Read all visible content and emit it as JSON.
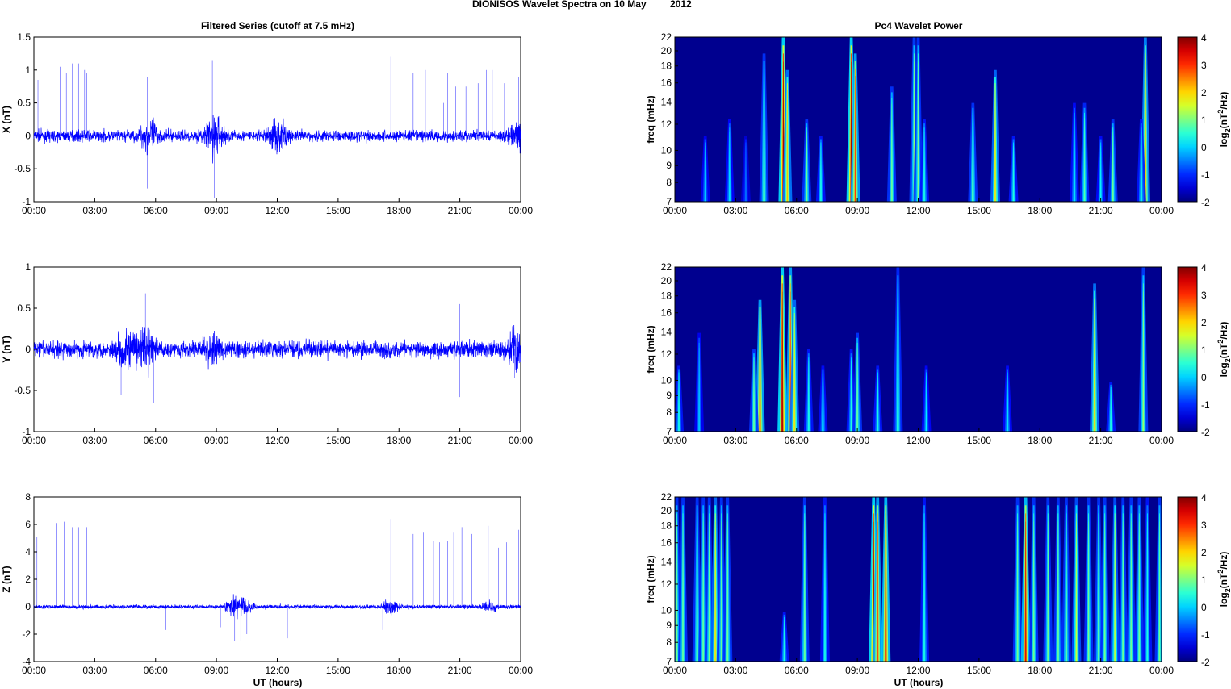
{
  "title": "DIONISOS Wavelet Spectra on 10 May",
  "year": "2012",
  "left_title": "Filtered Series (cutoff at 7.5 mHz)",
  "right_title": "Pc4 Wavelet Power",
  "xlabel": "UT (hours)",
  "x_ticks": [
    "00:00",
    "03:00",
    "06:00",
    "09:00",
    "12:00",
    "15:00",
    "18:00",
    "21:00",
    "00:00"
  ],
  "freq_label": "freq (mHz)",
  "freq_ticks": [
    7,
    8,
    9,
    10,
    12,
    14,
    16,
    18,
    20,
    22
  ],
  "colorbar": {
    "label": "log2(nT2/Hz)",
    "ticks": [
      -2,
      -1,
      0,
      1,
      2,
      3,
      4
    ],
    "range": [
      -2,
      4
    ]
  },
  "colors": {
    "line": "#0000ff",
    "background": "#00008f"
  },
  "chart_data": [
    {
      "type": "line",
      "ylabel": "X (nT)",
      "ylim": [
        -1,
        1.5
      ],
      "yticks": [
        -1,
        -0.5,
        0,
        0.5,
        1,
        1.5
      ],
      "noise": 0.06,
      "bursts": [
        [
          5.7,
          0.15
        ],
        [
          8.9,
          0.2
        ],
        [
          12.0,
          0.15
        ],
        [
          23.8,
          0.1
        ]
      ],
      "spikes": [
        [
          0.2,
          0.85
        ],
        [
          1.3,
          1.05
        ],
        [
          1.6,
          0.95
        ],
        [
          1.9,
          1.1
        ],
        [
          2.2,
          1.1
        ],
        [
          2.5,
          1.0
        ],
        [
          2.6,
          0.95
        ],
        [
          5.6,
          0.9
        ],
        [
          8.8,
          1.15
        ],
        [
          8.9,
          -0.95
        ],
        [
          17.6,
          1.2
        ],
        [
          18.7,
          0.95
        ],
        [
          19.3,
          1.0
        ],
        [
          20.2,
          0.5
        ],
        [
          20.4,
          0.95
        ],
        [
          20.8,
          0.75
        ],
        [
          21.3,
          0.75
        ],
        [
          21.9,
          0.8
        ],
        [
          22.3,
          1.0
        ],
        [
          22.6,
          1.0
        ],
        [
          23.2,
          0.8
        ],
        [
          23.9,
          0.9
        ],
        [
          5.6,
          -0.8
        ]
      ]
    },
    {
      "type": "line",
      "ylabel": "Y (nT)",
      "ylim": [
        -1,
        1
      ],
      "yticks": [
        -1,
        -0.5,
        0,
        0.5,
        1
      ],
      "noise": 0.07,
      "bursts": [
        [
          4.5,
          0.12
        ],
        [
          5.5,
          0.2
        ],
        [
          8.8,
          0.08
        ],
        [
          23.8,
          0.12
        ]
      ],
      "spikes": [
        [
          5.5,
          0.68
        ],
        [
          5.9,
          -0.65
        ],
        [
          4.3,
          -0.55
        ],
        [
          21.0,
          0.55
        ],
        [
          21.0,
          -0.58
        ],
        [
          23.7,
          -0.35
        ]
      ]
    },
    {
      "type": "line",
      "ylabel": "Z (nT)",
      "ylim": [
        -4,
        8
      ],
      "yticks": [
        -4,
        -2,
        0,
        2,
        4,
        6,
        8
      ],
      "noise": 0.1,
      "bursts": [
        [
          9.9,
          0.4
        ],
        [
          10.4,
          0.3
        ],
        [
          17.6,
          0.3
        ],
        [
          22.5,
          0.2
        ]
      ],
      "spikes": [
        [
          0.15,
          5.1
        ],
        [
          1.1,
          6.1
        ],
        [
          1.5,
          6.2
        ],
        [
          1.9,
          5.8
        ],
        [
          2.2,
          5.8
        ],
        [
          2.6,
          5.8
        ],
        [
          6.9,
          2.0
        ],
        [
          6.5,
          -1.7
        ],
        [
          7.5,
          -2.3
        ],
        [
          9.2,
          -1.5
        ],
        [
          9.9,
          -2.5
        ],
        [
          10.2,
          -2.5
        ],
        [
          10.5,
          -2
        ],
        [
          12.5,
          -2.3
        ],
        [
          17.2,
          -1.7
        ],
        [
          17.6,
          6.4
        ],
        [
          18.7,
          5.3
        ],
        [
          19.2,
          5.4
        ],
        [
          19.7,
          4.8
        ],
        [
          20.0,
          4.7
        ],
        [
          20.4,
          4.8
        ],
        [
          20.7,
          5.4
        ],
        [
          21.1,
          5.8
        ],
        [
          21.6,
          5.3
        ],
        [
          22.4,
          5.9
        ],
        [
          22.9,
          4.3
        ],
        [
          23.3,
          4.7
        ],
        [
          23.9,
          5.6
        ]
      ]
    },
    {
      "type": "heatmap",
      "events": [
        [
          4.4,
          1,
          0.9
        ],
        [
          5.35,
          4,
          1
        ],
        [
          5.55,
          2.2,
          0.8
        ],
        [
          6.5,
          1,
          0.5
        ],
        [
          7.2,
          0.5,
          0.4
        ],
        [
          8.7,
          4,
          1
        ],
        [
          8.9,
          3,
          0.9
        ],
        [
          10.7,
          1,
          0.7
        ],
        [
          11.8,
          1.2,
          1
        ],
        [
          12.0,
          1,
          1
        ],
        [
          12.3,
          0.5,
          0.5
        ],
        [
          14.7,
          1,
          0.6
        ],
        [
          15.8,
          2,
          0.8
        ],
        [
          16.7,
          0.5,
          0.4
        ],
        [
          19.7,
          0.3,
          0.6
        ],
        [
          20.2,
          0.8,
          0.6
        ],
        [
          21.0,
          0.3,
          0.4
        ],
        [
          21.6,
          1,
          0.5
        ],
        [
          23.2,
          2.5,
          1
        ],
        [
          23.0,
          0.5,
          0.5
        ],
        [
          1.5,
          0,
          0.4
        ],
        [
          2.7,
          0.2,
          0.5
        ],
        [
          3.5,
          -0.5,
          0.4
        ]
      ]
    },
    {
      "type": "heatmap",
      "events": [
        [
          0.2,
          0.5,
          0.4
        ],
        [
          1.2,
          0,
          0.6
        ],
        [
          4.2,
          3,
          0.8
        ],
        [
          3.9,
          1,
          0.5
        ],
        [
          5.3,
          4,
          1
        ],
        [
          5.7,
          3,
          1
        ],
        [
          5.9,
          2,
          0.8
        ],
        [
          6.6,
          0.5,
          0.5
        ],
        [
          7.3,
          0.3,
          0.4
        ],
        [
          8.7,
          0.5,
          0.5
        ],
        [
          9.0,
          1,
          0.6
        ],
        [
          10.0,
          0.5,
          0.4
        ],
        [
          11.0,
          0.8,
          1
        ],
        [
          12.4,
          0.2,
          0.4
        ],
        [
          16.4,
          0.3,
          0.4
        ],
        [
          20.7,
          2.2,
          0.9
        ],
        [
          21.5,
          0.5,
          0.3
        ],
        [
          23.1,
          1.2,
          1
        ]
      ]
    },
    {
      "type": "heatmap",
      "events": [
        [
          0.1,
          1,
          1
        ],
        [
          0.4,
          1,
          1
        ],
        [
          1.1,
          1,
          1
        ],
        [
          1.4,
          1,
          1
        ],
        [
          1.7,
          1,
          1
        ],
        [
          2.0,
          2,
          1
        ],
        [
          2.3,
          1,
          1
        ],
        [
          2.6,
          1,
          1
        ],
        [
          5.4,
          0.5,
          0.3
        ],
        [
          6.4,
          1,
          1
        ],
        [
          7.4,
          0.5,
          1
        ],
        [
          9.8,
          4,
          1
        ],
        [
          10.0,
          3,
          1
        ],
        [
          10.4,
          3.5,
          1
        ],
        [
          12.3,
          0.5,
          1
        ],
        [
          16.9,
          1,
          1
        ],
        [
          17.3,
          3.5,
          1
        ],
        [
          17.7,
          1,
          1
        ],
        [
          18.4,
          1,
          1
        ],
        [
          18.9,
          1,
          1
        ],
        [
          19.3,
          1,
          1
        ],
        [
          19.8,
          1.5,
          1
        ],
        [
          20.4,
          1,
          1
        ],
        [
          20.9,
          1,
          1
        ],
        [
          21.2,
          1,
          1
        ],
        [
          21.7,
          1.5,
          1
        ],
        [
          22.1,
          1,
          1
        ],
        [
          22.5,
          1,
          1
        ],
        [
          22.9,
          1,
          1
        ],
        [
          23.3,
          0.5,
          1
        ],
        [
          23.9,
          1,
          1
        ]
      ]
    }
  ]
}
